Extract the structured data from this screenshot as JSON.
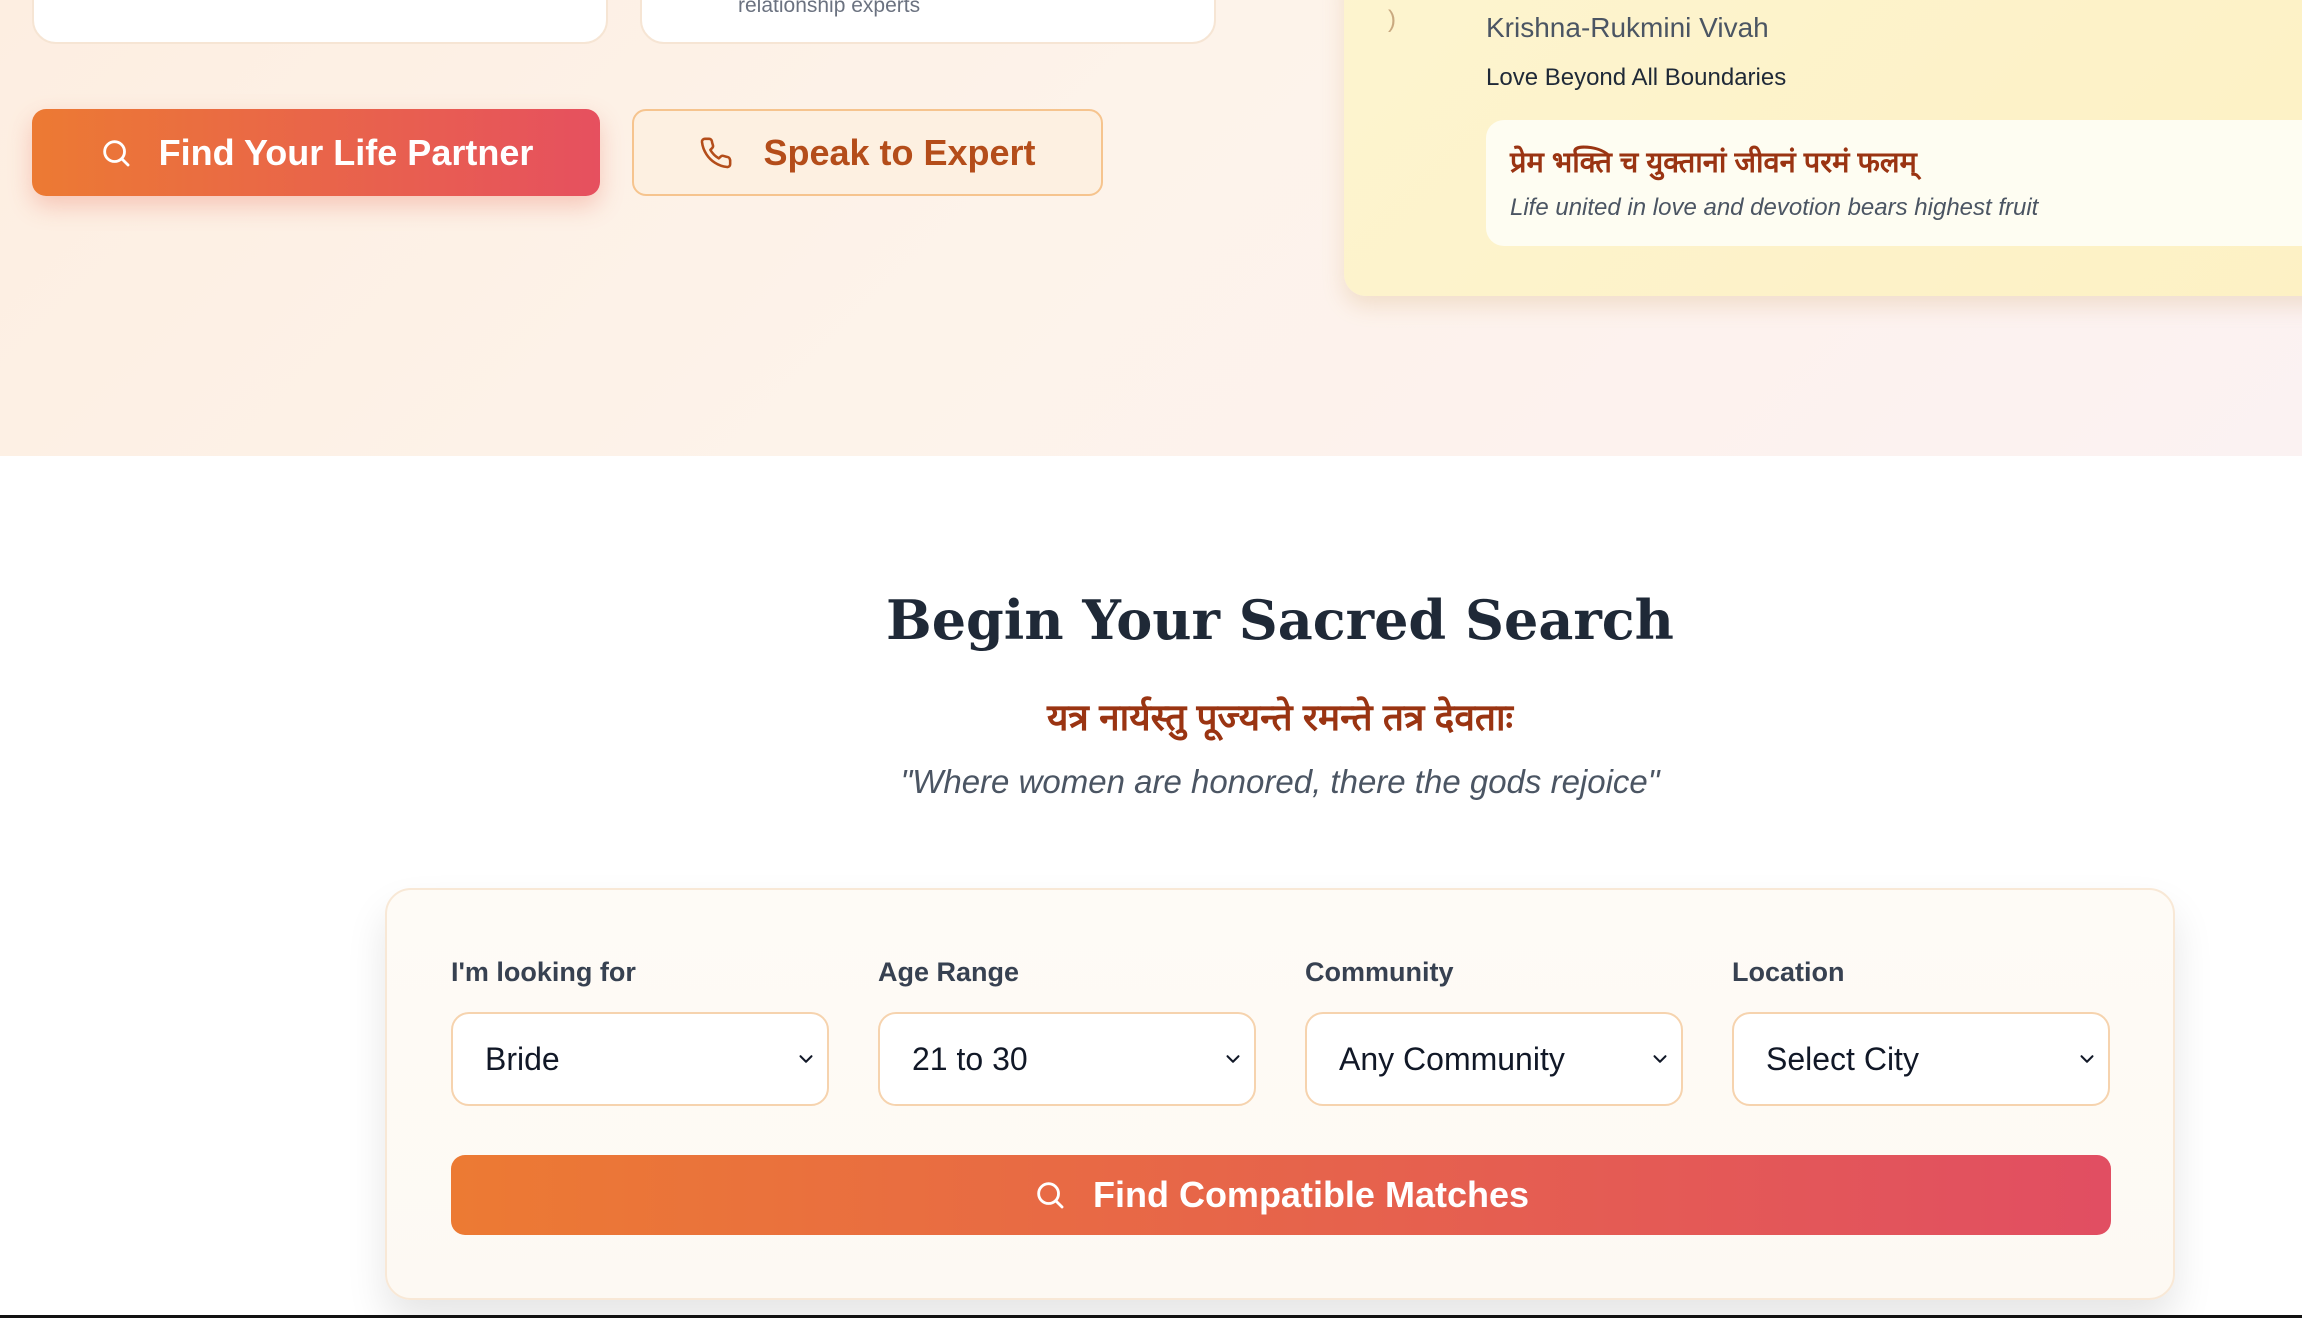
{
  "hero": {
    "stat_card_subtext": "relationship experts",
    "find_partner_label": "Find Your Life Partner",
    "speak_expert_label": "Speak to Expert",
    "quote_card": {
      "title": "Krishna-Rukmini Vivah",
      "subtitle": "Love Beyond All Boundaries",
      "sanskrit": "प्रेम भक्ति च युक्तानां जीवनं परमं फलम्",
      "translation": "Life united in love and devotion bears highest fruit"
    }
  },
  "search_section": {
    "title": "Begin Your Sacred Search",
    "sanskrit": "यत्र नार्यस्तु पूज्यन्ते रमन्ते तत्र देवताः",
    "quote": "\"Where women are honored, there the gods rejoice\"",
    "fields": {
      "looking_for": {
        "label": "I'm looking for",
        "value": "Bride"
      },
      "age_range": {
        "label": "Age Range",
        "value": "21 to 30"
      },
      "community": {
        "label": "Community",
        "value": "Any Community"
      },
      "location": {
        "label": "Location",
        "value": "Select City"
      }
    },
    "submit_label": "Find Compatible Matches"
  },
  "colors": {
    "accent_gradient_start": "#ec7a33",
    "accent_gradient_end": "#e6505f",
    "sanskrit_text": "#9a3412",
    "heading": "#1f2937"
  },
  "icons": {
    "search": "search-icon",
    "phone": "phone-icon",
    "dropdown": "chevron-down-icon"
  }
}
